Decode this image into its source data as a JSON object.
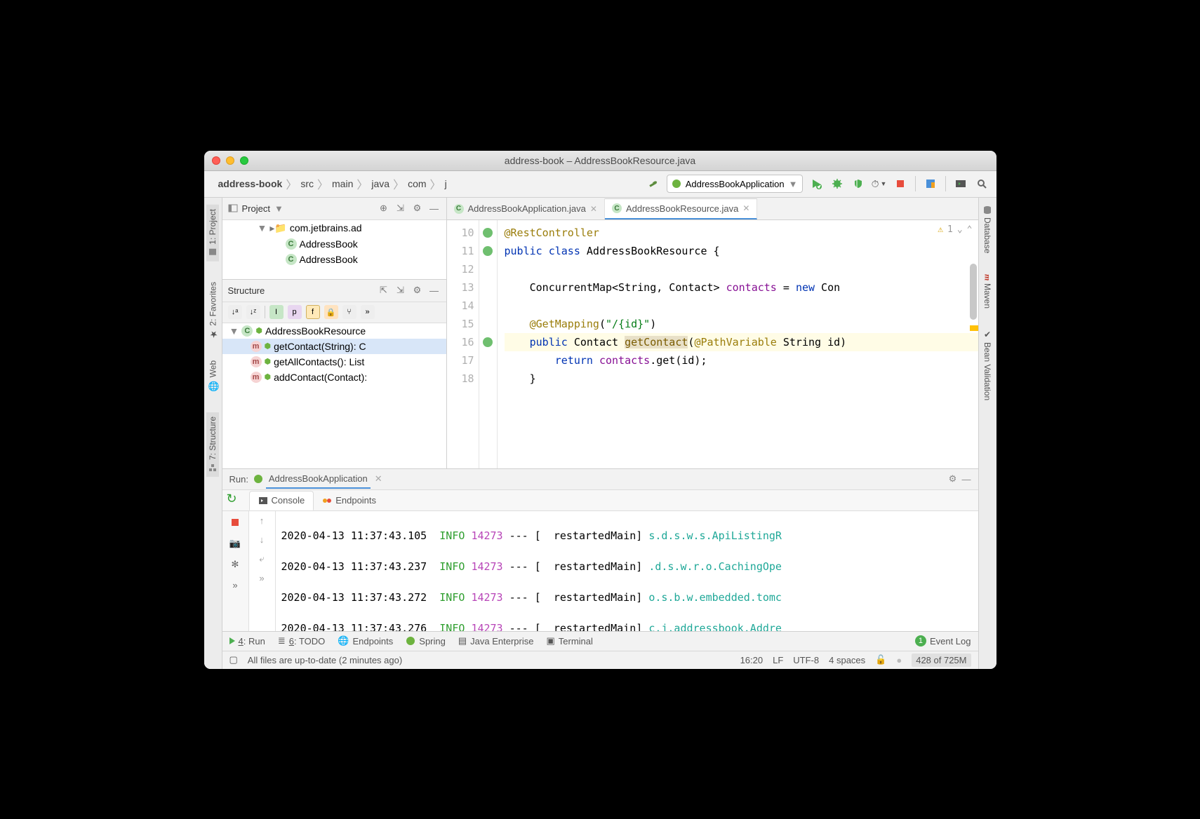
{
  "title": "address-book – AddressBookResource.java",
  "breadcrumbs": [
    "address-book",
    "src",
    "main",
    "java",
    "com",
    "j"
  ],
  "run_config": "AddressBookApplication",
  "left_gutter": [
    {
      "label": "1: Project",
      "icon": "project"
    },
    {
      "label": "2: Favorites",
      "icon": "star"
    },
    {
      "label": "Web",
      "icon": "globe"
    },
    {
      "label": "7: Structure",
      "icon": "structure"
    }
  ],
  "right_gutter": [
    {
      "label": "Database",
      "icon": "db"
    },
    {
      "label": "Maven",
      "icon": "maven"
    },
    {
      "label": "Bean Validation",
      "icon": "check"
    }
  ],
  "project_panel": {
    "title": "Project",
    "tree": [
      {
        "indent": 1,
        "arrow": "▼",
        "icon": "folder",
        "label": "com.jetbrains.ad"
      },
      {
        "indent": 2,
        "icon": "c",
        "label": "AddressBook"
      },
      {
        "indent": 2,
        "icon": "c",
        "label": "AddressBook"
      }
    ]
  },
  "structure_panel": {
    "title": "Structure",
    "root": "AddressBookResource",
    "members": [
      {
        "icon": "m",
        "label": "getContact(String): C",
        "sel": true
      },
      {
        "icon": "m",
        "label": "getAllContacts(): List"
      },
      {
        "icon": "m",
        "label": "addContact(Contact):"
      }
    ]
  },
  "editor_tabs": [
    {
      "label": "AddressBookApplication.java",
      "active": false
    },
    {
      "label": "AddressBookResource.java",
      "active": true
    }
  ],
  "inspect": {
    "count": "1"
  },
  "gutter_lines": [
    "10",
    "11",
    "12",
    "13",
    "14",
    "15",
    "16",
    "17",
    "18"
  ],
  "code": {
    "l10": {
      "ann": "@RestController"
    },
    "l11": {
      "kw1": "public",
      "kw2": "class",
      "name": "AddressBookResource",
      "brace": " {"
    },
    "l13": {
      "pre": "    ",
      "typ": "ConcurrentMap<String, Contact> ",
      "fld": "contacts",
      "rest": " = ",
      "kw": "new",
      "tail": " Con"
    },
    "l15": {
      "pre": "    ",
      "ann": "@GetMapping",
      "paren": "(",
      "str": "\"/{id}\"",
      "close": ")"
    },
    "l16": {
      "pre": "    ",
      "kw": "public",
      "sp": " ",
      "typ": "Contact ",
      "mtd": "getContact",
      "open": "(",
      "ann": "@PathVariable",
      "rest": " String id)"
    },
    "l17": {
      "pre": "        ",
      "kw": "return",
      "sp": " ",
      "fld": "contacts",
      "rest": ".get(id);"
    },
    "l18": {
      "pre": "    }",
      "": ""
    }
  },
  "run": {
    "title": "Run:",
    "config": "AddressBookApplication",
    "tabs": [
      "Console",
      "Endpoints"
    ],
    "log": [
      {
        "ts": "2020-04-13 11:37:43.105",
        "lvl": "INFO",
        "pid": "14273",
        "thr": "restartedMain",
        "logger": "s.d.s.w.s.ApiListingR"
      },
      {
        "ts": "2020-04-13 11:37:43.237",
        "lvl": "INFO",
        "pid": "14273",
        "thr": "restartedMain",
        "logger": ".d.s.w.r.o.CachingOpe"
      },
      {
        "ts": "2020-04-13 11:37:43.272",
        "lvl": "INFO",
        "pid": "14273",
        "thr": "restartedMain",
        "logger": "o.s.b.w.embedded.tomc"
      },
      {
        "ts": "2020-04-13 11:37:43.276",
        "lvl": "INFO",
        "pid": "14273",
        "thr": "restartedMain",
        "logger": "c.j.addressbook.Addre"
      }
    ]
  },
  "bottom_tools": [
    {
      "icon": "play",
      "label": "4: Run",
      "u": true
    },
    {
      "icon": "todo",
      "label": "6: TODO",
      "u": true
    },
    {
      "icon": "globe",
      "label": "Endpoints"
    },
    {
      "icon": "spring",
      "label": "Spring"
    },
    {
      "icon": "jee",
      "label": "Java Enterprise"
    },
    {
      "icon": "term",
      "label": "Terminal"
    }
  ],
  "event_log": "Event Log",
  "status": {
    "msg": "All files are up-to-date (2 minutes ago)",
    "pos": "16:20",
    "eol": "LF",
    "enc": "UTF-8",
    "indent": "4 spaces",
    "mem": "428 of 725M"
  }
}
